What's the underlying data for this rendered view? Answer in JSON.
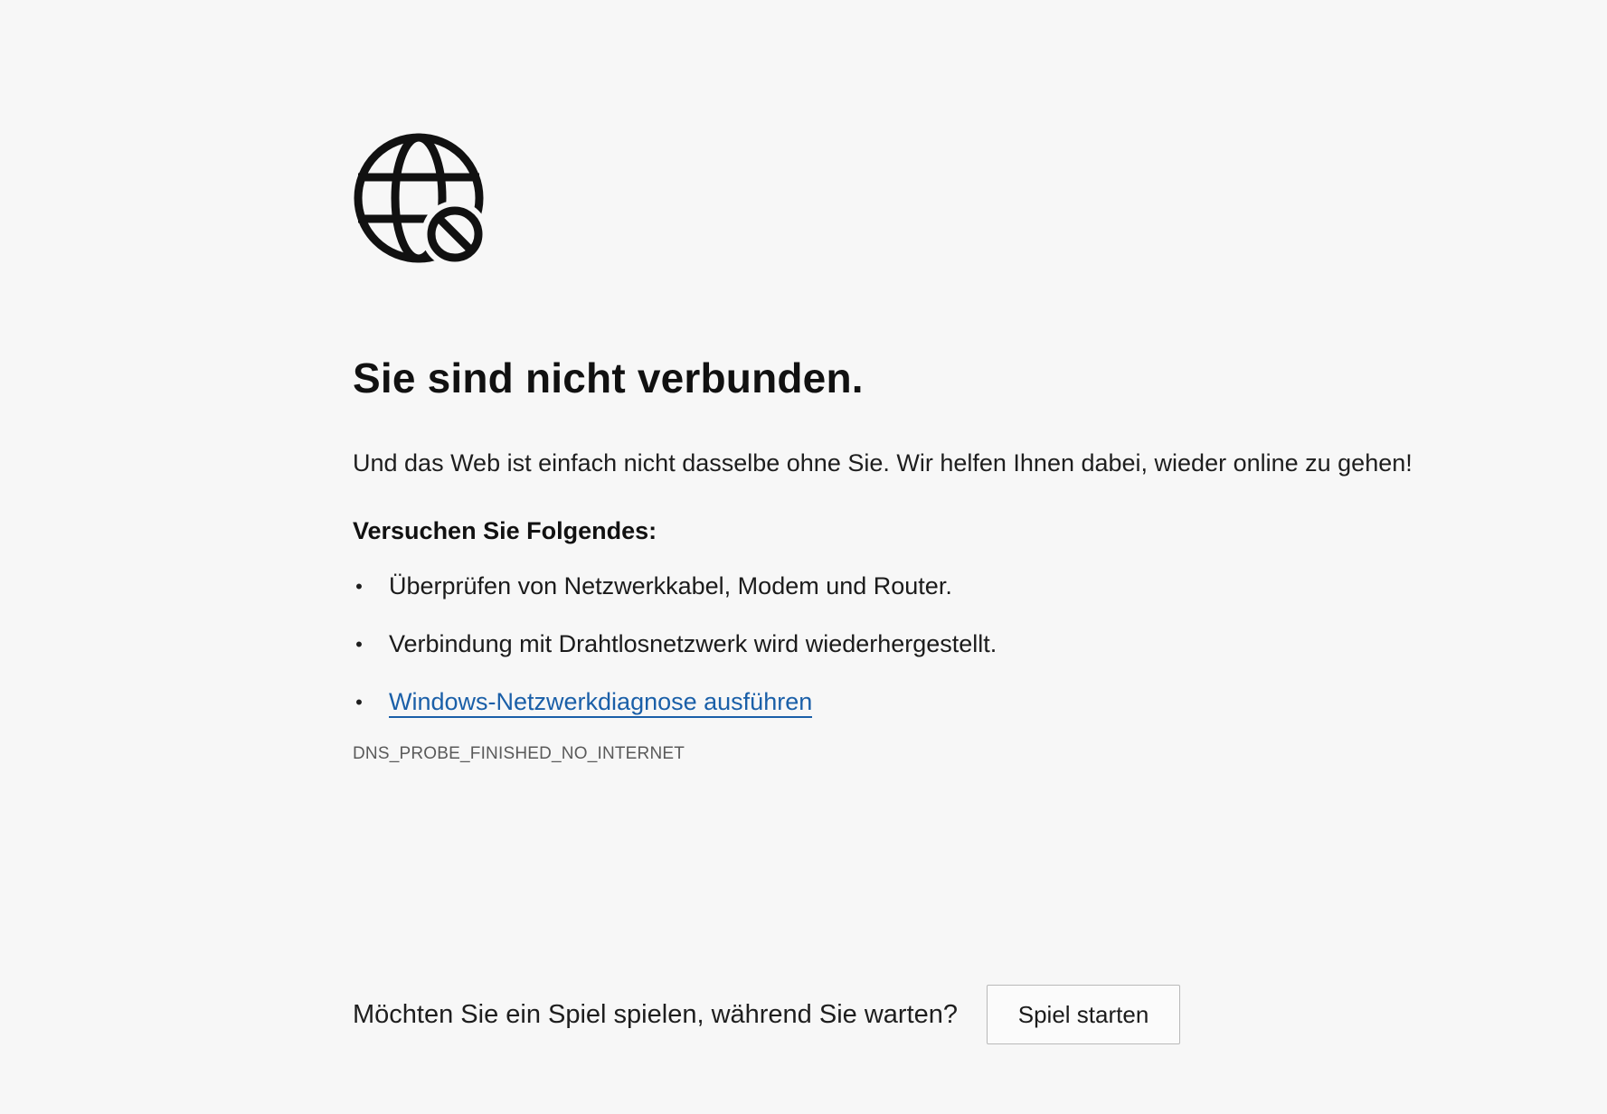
{
  "page": {
    "icon": "globe-blocked-icon",
    "title": "Sie sind nicht verbunden.",
    "subtitle": "Und das Web ist einfach nicht dasselbe ohne Sie. Wir helfen Ihnen dabei, wieder online zu gehen!",
    "suggestions_heading": "Versuchen Sie Folgendes:",
    "bullet_char": "•",
    "suggestions": [
      {
        "label": "Überprüfen von Netzwerkkabel, Modem und Router."
      },
      {
        "label": "Verbindung mit Drahtlosnetzwerk wird wiederhergestellt."
      },
      {
        "label": "Windows-Netzwerkdiagnose ausführen"
      }
    ],
    "error_code": "DNS_PROBE_FINISHED_NO_INTERNET"
  },
  "game": {
    "question": "Möchten Sie ein Spiel spielen, während Sie warten?",
    "button_label": "Spiel starten"
  },
  "colors": {
    "background": "#f7f7f7",
    "text": "#1b1b1b",
    "link": "#1a5fa8",
    "error_code": "#5a5a5a"
  }
}
